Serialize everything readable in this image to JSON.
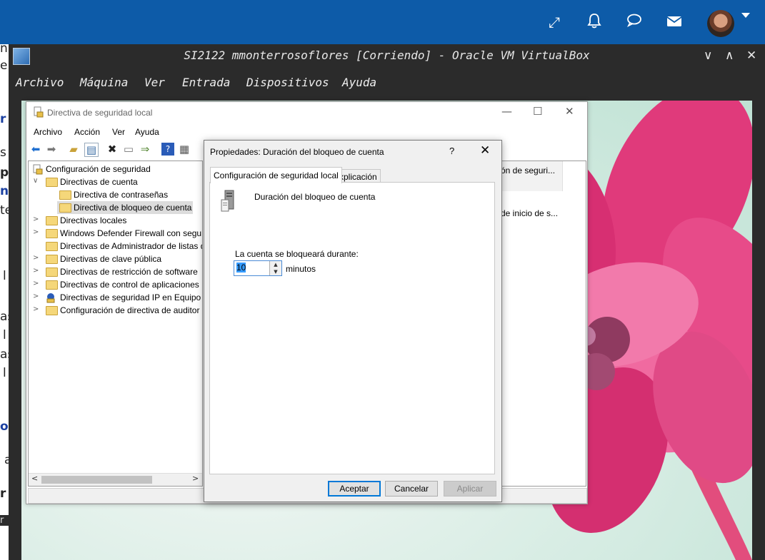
{
  "host": {
    "topbar_icons": [
      "expand-icon",
      "bell-icon",
      "chat-icon",
      "mail-icon"
    ],
    "left_page_fragments": [
      "n",
      "e",
      "r",
      "s",
      "p",
      "n",
      "te",
      "l",
      "as",
      "l",
      "as",
      "l",
      "o",
      "a",
      "r",
      "r"
    ]
  },
  "vbox": {
    "title": "SI2122 mmonterrosoflores [Corriendo] - Oracle VM VirtualBox",
    "menu": [
      "Archivo",
      "Máquina",
      "Ver",
      "Entrada",
      "Dispositivos",
      "Ayuda"
    ],
    "controls": {
      "minimize": "∨",
      "maximize": "∧",
      "close": "✕"
    }
  },
  "secpol": {
    "title": "Directiva de seguridad local",
    "menu": [
      "Archivo",
      "Acción",
      "Ver",
      "Ayuda"
    ],
    "controls": {
      "minimize": "—",
      "maximize": "☐",
      "close": "✕"
    },
    "tree": [
      {
        "label": "Configuración de seguridad",
        "level": 0,
        "expander": ""
      },
      {
        "label": "Directivas de cuenta",
        "level": 1,
        "expander": "∨"
      },
      {
        "label": "Directiva de contraseñas",
        "level": 2,
        "expander": ""
      },
      {
        "label": "Directiva de bloqueo de cuenta",
        "level": 2,
        "expander": "",
        "selected": true
      },
      {
        "label": "Directivas locales",
        "level": 1,
        "expander": ">"
      },
      {
        "label": "Windows Defender Firewall con seguri",
        "level": 1,
        "expander": ">"
      },
      {
        "label": "Directivas de Administrador de listas d",
        "level": 1,
        "expander": ""
      },
      {
        "label": "Directivas de clave pública",
        "level": 1,
        "expander": ">"
      },
      {
        "label": "Directivas de restricción de software",
        "level": 1,
        "expander": ">"
      },
      {
        "label": "Directivas de control de aplicaciones",
        "level": 1,
        "expander": ">"
      },
      {
        "label": "Directivas de seguridad IP en Equipo l",
        "level": 1,
        "expander": ">"
      },
      {
        "label": "Configuración de directiva de auditor",
        "level": 1,
        "expander": ">"
      }
    ],
    "right_pane": {
      "header": "ón de seguri...",
      "row": "de inicio de s..."
    }
  },
  "dialog": {
    "title": "Propiedades: Duración del bloqueo de cuenta",
    "help": "?",
    "close": "✕",
    "tabs": [
      "Configuración de seguridad local",
      "Explicación"
    ],
    "policy_name": "Duración del bloqueo de cuenta",
    "field_label": "La cuenta se bloqueará durante:",
    "field_value": "10",
    "unit": "minutos",
    "buttons": {
      "ok": "Aceptar",
      "cancel": "Cancelar",
      "apply": "Aplicar"
    }
  }
}
